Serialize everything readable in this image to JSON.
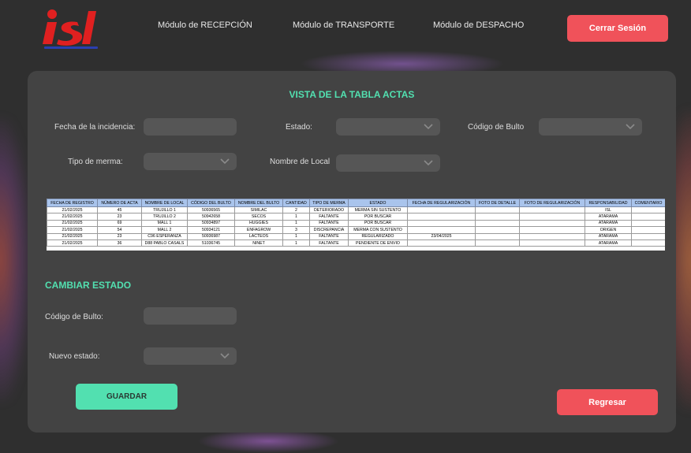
{
  "header": {
    "logo_text": "isl",
    "nav": [
      "Módulo de RECEPCIÓN",
      "Módulo de TRANSPORTE",
      "Módulo de DESPACHO"
    ],
    "logout_label": "Cerrar Sesión"
  },
  "colors": {
    "accent_green": "#52e0b0",
    "button_red": "#f0525a",
    "logo_red": "#e02020",
    "logo_blue": "#2a3fb0"
  },
  "main": {
    "title": "VISTA DE LA TABLA ACTAS",
    "filters": {
      "fecha_label": "Fecha de la incidencia:",
      "estado_label": "Estado:",
      "codigo_label": "Código de Bulto",
      "merma_label": "Tipo de merma:",
      "local_label": "Nombre de Local"
    },
    "table": {
      "headers": [
        "FECHA DE REGISTRO",
        "NÚMERO DE ACTA",
        "NOMBRE DE LOCAL",
        "CÓDIGO DEL BULTO",
        "NOMBRE DEL BULTO",
        "CANTIDAD",
        "TIPO DE MERMA",
        "ESTADO",
        "FECHA DE REGULARIZACIÓN",
        "FOTO DE DETALLE",
        "FOTO DE REGULARIZACIÓN",
        "RESPONSABILIDAD",
        "COMENTARIO"
      ],
      "rows": [
        [
          "21/02/2025",
          "45",
          "TRUJILLO 1",
          "50936565",
          "SIMILAC",
          "2",
          "DETERIORADO",
          "MERMA SIN SUSTENTO",
          "",
          "",
          "",
          "ISL",
          ""
        ],
        [
          "21/02/2025",
          "23",
          "TRUJILLO 2",
          "50942658",
          "SECOS",
          "1",
          "FALTANTE",
          "POR BUSCAR",
          "",
          "",
          "",
          "ATARAMA",
          ""
        ],
        [
          "21/02/2025",
          "69",
          "MALL 1",
          "50934897",
          "HUGGIES",
          "1",
          "FALTANTE",
          "POR BUSCAR",
          "",
          "",
          "",
          "ATARAMA",
          ""
        ],
        [
          "21/02/2025",
          "54",
          "MALL 2",
          "50934121",
          "ENFAGROW",
          "3",
          "DISCREPANCIA",
          "MERMA CON SUSTENTO",
          "",
          "",
          "",
          "ORIGEN",
          ""
        ],
        [
          "21/02/2025",
          "23",
          "C96 ESPERANZA",
          "50936987",
          "LACTEOS",
          "1",
          "FALTANTE",
          "REGULARIZADO",
          "23/04/2025",
          "",
          "",
          "ATARAMA",
          ""
        ],
        [
          "21/02/2025",
          "36",
          "D88 PABLO CASALS",
          "51036745",
          "NINET",
          "1",
          "FALTANTE",
          "PENDIENTE DE ENVIO",
          "",
          "",
          "",
          "ATARAMA",
          ""
        ]
      ]
    },
    "cambiar": {
      "title": "CAMBIAR ESTADO",
      "codigo_label": "Código de Bulto:",
      "nuevo_label": "Nuevo estado:",
      "save_label": "GUARDAR",
      "back_label": "Regresar"
    }
  }
}
